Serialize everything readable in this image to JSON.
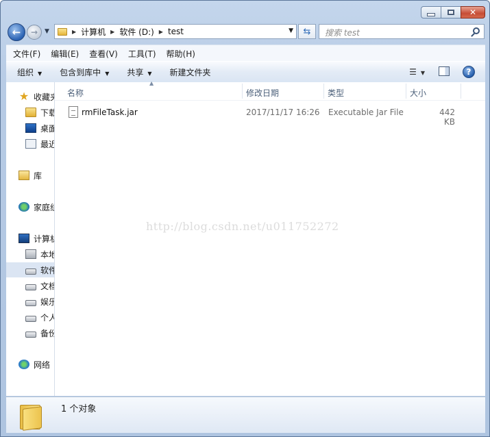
{
  "window": {
    "minimize": "minimize",
    "maximize": "maximize",
    "close": "✕"
  },
  "address": {
    "crumbs": [
      "计算机",
      "软件 (D:)",
      "test"
    ]
  },
  "search": {
    "placeholder": "搜索 test"
  },
  "menu": [
    "文件(F)",
    "编辑(E)",
    "查看(V)",
    "工具(T)",
    "帮助(H)"
  ],
  "toolbar": {
    "organize": "组织",
    "include_library": "包含到库中",
    "share": "共享",
    "new_folder": "新建文件夹"
  },
  "nav": {
    "favorites": "收藏夹",
    "downloads": "下载",
    "desktop": "桌面",
    "recent": "最近访问的位置",
    "libraries": "库",
    "homegroup": "家庭组",
    "computer": "计算机",
    "local_disk": "本地磁盘 (C:)",
    "drive_software": "软件 (D:)",
    "drive_docs": "文档 (E:)",
    "drive_ent": "娱乐 (F:)",
    "drive_personal": "个人 (G:)",
    "drive_backup": "备份 (H:)",
    "network": "网络"
  },
  "columns": {
    "name": "名称",
    "date": "修改日期",
    "type": "类型",
    "size": "大小"
  },
  "files": [
    {
      "name": "rmFileTask.jar",
      "date": "2017/11/17 16:26",
      "type": "Executable Jar File",
      "size": "442 KB"
    }
  ],
  "watermark": "http://blog.csdn.net/u011752272",
  "status": {
    "count": "1 个对象"
  },
  "icons": {
    "back": "back-arrow-icon",
    "forward": "forward-arrow-icon",
    "refresh": "refresh-icon",
    "search": "search-icon",
    "help": "help-icon"
  }
}
